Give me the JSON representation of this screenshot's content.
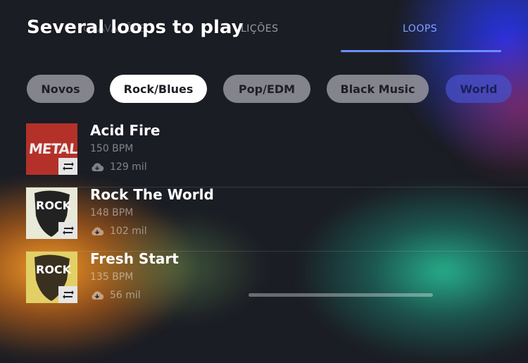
{
  "header": {
    "overlay_title": "Several loops to play",
    "tabs": [
      {
        "label": "GRAVAÇÕES"
      },
      {
        "label": "LIÇÕES"
      },
      {
        "label": "LOOPS"
      }
    ]
  },
  "genres": [
    {
      "label": "Novos"
    },
    {
      "label": "Rock/Blues"
    },
    {
      "label": "Pop/EDM"
    },
    {
      "label": "Black Music"
    },
    {
      "label": "World"
    }
  ],
  "selected_genre": "Rock/Blues",
  "loops": [
    {
      "title": "Acid Fire",
      "bpm": "150 BPM",
      "downloads": "129 mil",
      "cover_text": "METAL"
    },
    {
      "title": "Rock The World",
      "bpm": "148 BPM",
      "downloads": "102 mil",
      "cover_text": "ROCK"
    },
    {
      "title": "Fresh Start",
      "bpm": "135 BPM",
      "downloads": "56 mil",
      "cover_text": "ROCK"
    }
  ],
  "colors": {
    "accent": "#6a8fff",
    "chip_active": "#ffffff",
    "chip_inactive": "#96969f"
  },
  "icons": [
    "loop-icon",
    "cloud-download-icon"
  ]
}
